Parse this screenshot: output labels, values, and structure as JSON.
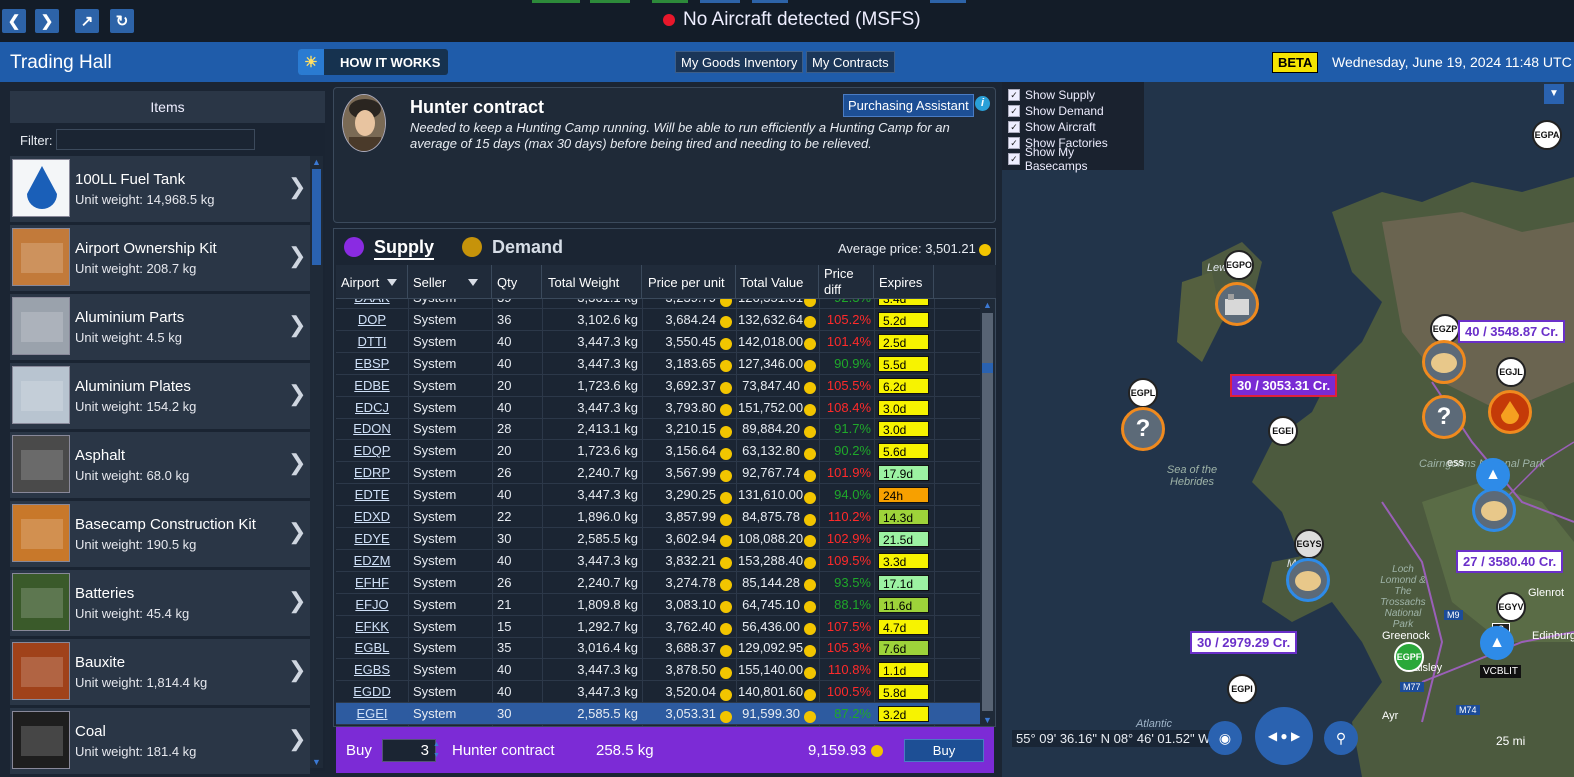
{
  "topbar": {
    "status": "No Aircraft detected (MSFS)",
    "icons": [
      "back-icon",
      "forward-icon",
      "open-external-icon",
      "refresh-icon"
    ]
  },
  "header": {
    "title": "Trading Hall",
    "how_it_works": "HOW IT WORKS",
    "my_goods": "My Goods Inventory",
    "my_contracts": "My Contracts",
    "beta": "BETA",
    "date": "Wednesday, June 19, 2024 11:48 UTC"
  },
  "items_panel": {
    "header": "Items",
    "filter_label": "Filter:",
    "filter_value": "",
    "items": [
      {
        "name": "100LL Fuel Tank",
        "weight": "Unit weight: 14,968.5 kg",
        "icon": "fuel-drop"
      },
      {
        "name": "Airport Ownership Kit",
        "weight": "Unit weight: 208.7 kg",
        "icon": "wood-planks"
      },
      {
        "name": "Aluminium Parts",
        "weight": "Unit weight: 4.5 kg",
        "icon": "metal-parts"
      },
      {
        "name": "Aluminium Plates",
        "weight": "Unit weight: 154.2 kg",
        "icon": "metal-plates"
      },
      {
        "name": "Asphalt",
        "weight": "Unit weight: 68.0 kg",
        "icon": "asphalt"
      },
      {
        "name": "Basecamp Construction Kit",
        "weight": "Unit weight: 190.5 kg",
        "icon": "toolbox"
      },
      {
        "name": "Batteries",
        "weight": "Unit weight: 45.4 kg",
        "icon": "battery"
      },
      {
        "name": "Bauxite",
        "weight": "Unit weight: 1,814.4 kg",
        "icon": "bauxite"
      },
      {
        "name": "Coal",
        "weight": "Unit weight: 181.4 kg",
        "icon": "coal"
      }
    ]
  },
  "contract": {
    "title": "Hunter contract",
    "description": "Needed to keep a Hunting Camp running. Will be able to run efficiently a Hunting Camp for an average of 15 days (max 30 days) before being tired and needing to be relieved.",
    "assistant": "Purchasing Assistant",
    "info": "i"
  },
  "market": {
    "tab_supply": "Supply",
    "tab_demand": "Demand",
    "avg_label": "Average price: 3,501.21",
    "columns": [
      "Airport",
      "Seller",
      "Qty",
      "Total Weight",
      "Price per unit",
      "Total Value",
      "Price diff",
      "Expires"
    ],
    "rows": [
      {
        "ap": "DAAK",
        "seller": "System",
        "qty": "39",
        "tw": "3,361.1 kg",
        "ppu": "3,239.79",
        "tv": "126,351.81",
        "pd": "92.3%",
        "pdc": "green",
        "exp": "3.4d",
        "expc": "#f7f300"
      },
      {
        "ap": "DOP",
        "seller": "System",
        "qty": "36",
        "tw": "3,102.6 kg",
        "ppu": "3,684.24",
        "tv": "132,632.64",
        "pd": "105.2%",
        "pdc": "red",
        "exp": "5.2d",
        "expc": "#f7f300"
      },
      {
        "ap": "DTTI",
        "seller": "System",
        "qty": "40",
        "tw": "3,447.3 kg",
        "ppu": "3,550.45",
        "tv": "142,018.00",
        "pd": "101.4%",
        "pdc": "red",
        "exp": "2.5d",
        "expc": "#f7f300"
      },
      {
        "ap": "EBSP",
        "seller": "System",
        "qty": "40",
        "tw": "3,447.3 kg",
        "ppu": "3,183.65",
        "tv": "127,346.00",
        "pd": "90.9%",
        "pdc": "green",
        "exp": "5.5d",
        "expc": "#f7f300"
      },
      {
        "ap": "EDBE",
        "seller": "System",
        "qty": "20",
        "tw": "1,723.6 kg",
        "ppu": "3,692.37",
        "tv": "73,847.40",
        "pd": "105.5%",
        "pdc": "red",
        "exp": "6.2d",
        "expc": "#f7f300"
      },
      {
        "ap": "EDCJ",
        "seller": "System",
        "qty": "40",
        "tw": "3,447.3 kg",
        "ppu": "3,793.80",
        "tv": "151,752.00",
        "pd": "108.4%",
        "pdc": "red",
        "exp": "3.0d",
        "expc": "#f7f300"
      },
      {
        "ap": "EDON",
        "seller": "System",
        "qty": "28",
        "tw": "2,413.1 kg",
        "ppu": "3,210.15",
        "tv": "89,884.20",
        "pd": "91.7%",
        "pdc": "green",
        "exp": "3.0d",
        "expc": "#f7f300"
      },
      {
        "ap": "EDQP",
        "seller": "System",
        "qty": "20",
        "tw": "1,723.6 kg",
        "ppu": "3,156.64",
        "tv": "63,132.80",
        "pd": "90.2%",
        "pdc": "green",
        "exp": "5.6d",
        "expc": "#f7f300"
      },
      {
        "ap": "EDRP",
        "seller": "System",
        "qty": "26",
        "tw": "2,240.7 kg",
        "ppu": "3,567.99",
        "tv": "92,767.74",
        "pd": "101.9%",
        "pdc": "red",
        "exp": "17.9d",
        "expc": "#9cf2a2"
      },
      {
        "ap": "EDTE",
        "seller": "System",
        "qty": "40",
        "tw": "3,447.3 kg",
        "ppu": "3,290.25",
        "tv": "131,610.00",
        "pd": "94.0%",
        "pdc": "green",
        "exp": "24h",
        "expc": "#f7a000"
      },
      {
        "ap": "EDXD",
        "seller": "System",
        "qty": "22",
        "tw": "1,896.0 kg",
        "ppu": "3,857.99",
        "tv": "84,875.78",
        "pd": "110.2%",
        "pdc": "red",
        "exp": "14.3d",
        "expc": "#9ed33a"
      },
      {
        "ap": "EDYE",
        "seller": "System",
        "qty": "30",
        "tw": "2,585.5 kg",
        "ppu": "3,602.94",
        "tv": "108,088.20",
        "pd": "102.9%",
        "pdc": "red",
        "exp": "21.5d",
        "expc": "#9cf2a2"
      },
      {
        "ap": "EDZM",
        "seller": "System",
        "qty": "40",
        "tw": "3,447.3 kg",
        "ppu": "3,832.21",
        "tv": "153,288.40",
        "pd": "109.5%",
        "pdc": "red",
        "exp": "3.3d",
        "expc": "#f7f300"
      },
      {
        "ap": "EFHF",
        "seller": "System",
        "qty": "26",
        "tw": "2,240.7 kg",
        "ppu": "3,274.78",
        "tv": "85,144.28",
        "pd": "93.5%",
        "pdc": "green",
        "exp": "17.1d",
        "expc": "#9cf2a2"
      },
      {
        "ap": "EFJO",
        "seller": "System",
        "qty": "21",
        "tw": "1,809.8 kg",
        "ppu": "3,083.10",
        "tv": "64,745.10",
        "pd": "88.1%",
        "pdc": "green",
        "exp": "11.6d",
        "expc": "#9ed33a"
      },
      {
        "ap": "EFKK",
        "seller": "System",
        "qty": "15",
        "tw": "1,292.7 kg",
        "ppu": "3,762.40",
        "tv": "56,436.00",
        "pd": "107.5%",
        "pdc": "red",
        "exp": "4.7d",
        "expc": "#f7f300"
      },
      {
        "ap": "EGBL",
        "seller": "System",
        "qty": "35",
        "tw": "3,016.4 kg",
        "ppu": "3,688.37",
        "tv": "129,092.95",
        "pd": "105.3%",
        "pdc": "red",
        "exp": "7.6d",
        "expc": "#9ed33a"
      },
      {
        "ap": "EGBS",
        "seller": "System",
        "qty": "40",
        "tw": "3,447.3 kg",
        "ppu": "3,878.50",
        "tv": "155,140.00",
        "pd": "110.8%",
        "pdc": "red",
        "exp": "1.1d",
        "expc": "#f7f300"
      },
      {
        "ap": "EGDD",
        "seller": "System",
        "qty": "40",
        "tw": "3,447.3 kg",
        "ppu": "3,520.04",
        "tv": "140,801.60",
        "pd": "100.5%",
        "pdc": "red",
        "exp": "5.8d",
        "expc": "#f7f300"
      },
      {
        "ap": "EGEI",
        "seller": "System",
        "qty": "30",
        "tw": "2,585.5 kg",
        "ppu": "3,053.31",
        "tv": "91,599.30",
        "pd": "87.2%",
        "pdc": "green",
        "exp": "3.2d",
        "expc": "#f7f300",
        "selected": true
      }
    ]
  },
  "buybar": {
    "buy_label": "Buy",
    "qty": "3",
    "item": "Hunter contract",
    "weight": "258.5 kg",
    "total": "9,159.93",
    "button": "Buy"
  },
  "map": {
    "options": [
      "Show Supply",
      "Show Demand",
      "Show Aircraft",
      "Show Factories",
      "Show My Basecamps"
    ],
    "airports": {
      "egpa": "EGPA",
      "egpo": "EGPO",
      "egzp": "EGZP",
      "egjl": "EGJL",
      "egpl": "EGPL",
      "egei": "EGEI",
      "egys": "EGYS",
      "egyv": "EGYV",
      "egpf": "EGPF",
      "egpi": "EGPI",
      "vcblit": "VCBLIT",
      "count2": "2"
    },
    "prices": {
      "p1": "40 / 3548.87 Cr.",
      "p2": "30 / 3053.31 Cr.",
      "p3": "27 / 3580.40 Cr.",
      "p4": "30 / 2979.29 Cr."
    },
    "labels": {
      "hebrides": "Sea of the Hebrides",
      "cairngorms": "Cairngorms National Park",
      "loch": "Loch Lomond & The Trossachs National Park",
      "mull": "Mull",
      "lewis": "Lew",
      "greenock": "Greenock",
      "paisley": "aisley",
      "ayr": "Ayr",
      "glenrothes": "Glenrot",
      "edinburgh": "Edinburg",
      "atlantic": "Atlantic",
      "m9": "M9",
      "m77": "M77",
      "m74": "M74",
      "ness": "ess"
    },
    "coords": "55° 09' 36.16\" N 08° 46' 01.52\" W",
    "scale": "25 mi"
  }
}
